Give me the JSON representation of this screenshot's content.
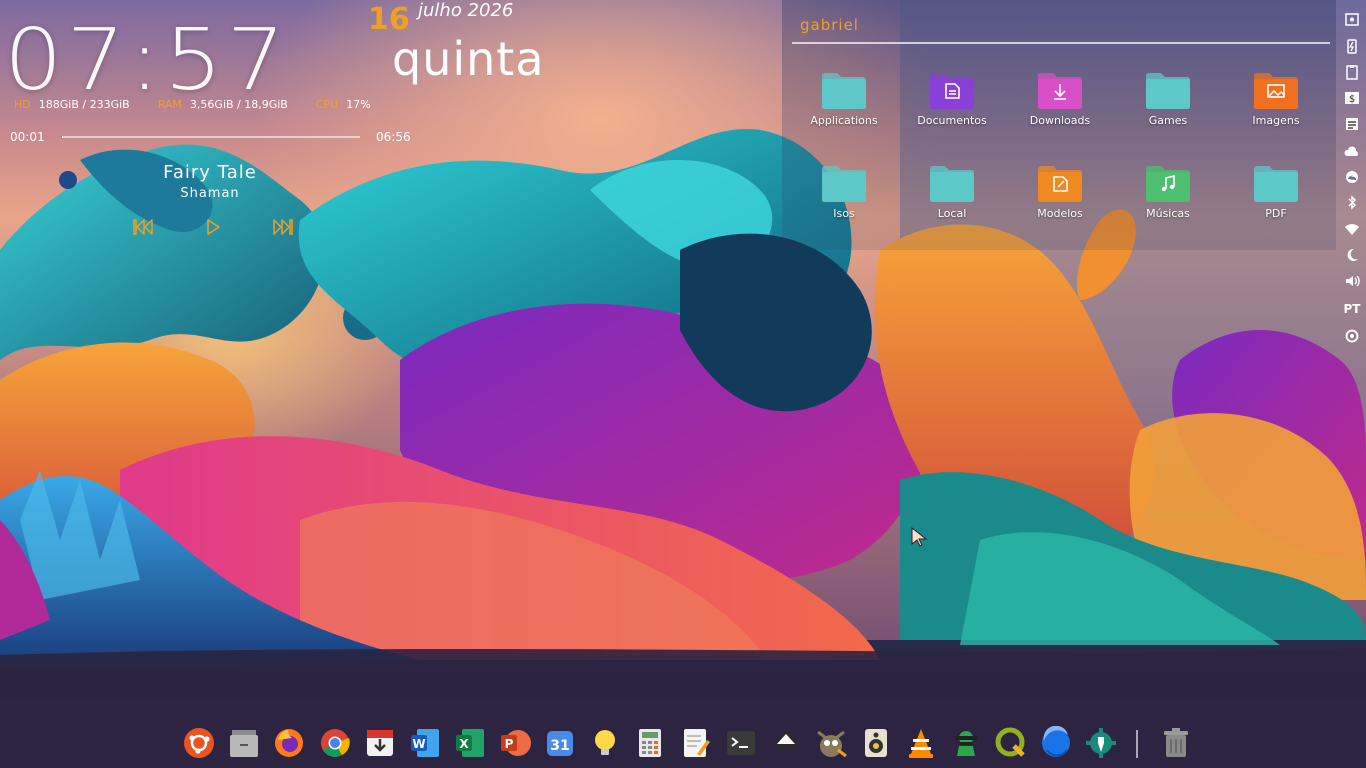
{
  "clock": {
    "time": "07:57",
    "day": "16",
    "month_year": "julho 2026",
    "weekday": "quinta"
  },
  "stats": {
    "hd_label": "HD",
    "hd_value": "188GiB / 233GiB",
    "ram_label": "RAM",
    "ram_value": "3,56GiB / 18,9GiB",
    "cpu_label": "CPU",
    "cpu_value": "17%"
  },
  "media": {
    "elapsed": "00:01",
    "total": "06:56",
    "progress": 0.003,
    "title": "Fairy Tale",
    "artist": "Shaman"
  },
  "panel": {
    "user": "gabriel",
    "folders": [
      {
        "label": "Applications",
        "icon": "folder-icon",
        "color": "#5ec8c8"
      },
      {
        "label": "Documentos",
        "icon": "documents-folder-icon",
        "color": "#8a3fd8"
      },
      {
        "label": "Downloads",
        "icon": "downloads-folder-icon",
        "color": "#d84fc8"
      },
      {
        "label": "Games",
        "icon": "folder-icon",
        "color": "#5ec8c8"
      },
      {
        "label": "Imagens",
        "icon": "images-folder-icon",
        "color": "#f07020"
      },
      {
        "label": "Isos",
        "icon": "folder-icon",
        "color": "#5ec8c8"
      },
      {
        "label": "Local",
        "icon": "folder-icon",
        "color": "#5ec8c8"
      },
      {
        "label": "Modelos",
        "icon": "templates-folder-icon",
        "color": "#f08a20"
      },
      {
        "label": "Músicas",
        "icon": "music-folder-icon",
        "color": "#4cc070"
      },
      {
        "label": "PDF",
        "icon": "folder-icon",
        "color": "#5ec8c8"
      }
    ]
  },
  "tray": {
    "language": "PT",
    "items": [
      "screenshot-icon",
      "battery-charging-icon",
      "clipboard-icon",
      "currency-icon",
      "notes-icon",
      "cloud-icon",
      "weather-icon",
      "bluetooth-icon",
      "wifi-icon",
      "night-mode-icon",
      "volume-icon",
      "language-indicator",
      "power-icon"
    ]
  },
  "dock": {
    "items": [
      "ubuntu-icon",
      "files-icon",
      "firefox-icon",
      "chrome-icon",
      "downloader-icon",
      "word-icon",
      "excel-icon",
      "powerpoint-icon",
      "calendar-icon",
      "lightbulb-icon",
      "calculator-icon",
      "text-editor-icon",
      "terminal-icon",
      "inkscape-icon",
      "gimp-icon",
      "speaker-icon",
      "vlc-icon",
      "hacker-icon",
      "qgis-icon",
      "earth-icon",
      "settings-tool-icon",
      "trash-icon"
    ],
    "calendar_number": "31",
    "word_letter": "W",
    "excel_letter": "X",
    "powerpoint_letter": "P"
  },
  "colors": {
    "accent": "#f0a020",
    "teal_folder": "#5ec8c8"
  }
}
